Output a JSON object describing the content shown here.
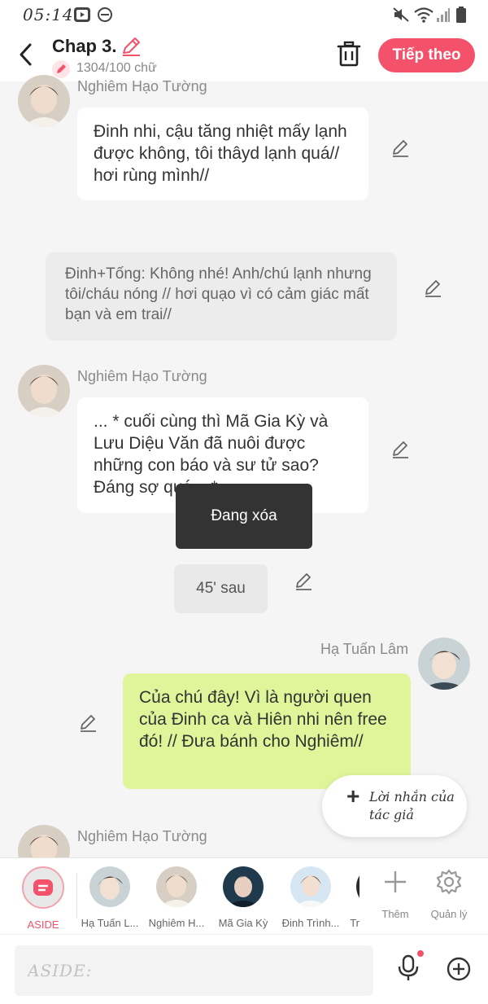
{
  "status_bar": {
    "time": "05:14"
  },
  "header": {
    "title": "Chap 3.",
    "word_count": "1304/100 chữ",
    "next_label": "Tiếp theo"
  },
  "messages": [
    {
      "sender": "Nghiêm Hạo Tường",
      "text": "Đinh nhi, cậu tăng nhiệt  mấy lạnh được không, tôi thâyd lạnh quá// hơi rùng mình//"
    },
    {
      "sender": "",
      "text": "Đinh+Tống: Không nhé! Anh/chú lạnh nhưng tôi/cháu nóng // hơi quạo vì có cảm giác mất bạn và em trai//"
    },
    {
      "sender": "Nghiêm Hạo Tường",
      "text": "... * cuối cùng thì Mã Gia Kỳ và Lưu Diệu Văn đã nuôi được những con báo và sư tử sao? Đáng sợ quá... *"
    },
    {
      "sender": "",
      "text": "45' sau"
    },
    {
      "sender": "Hạ Tuấn Lâm",
      "text": "Của chú đây! Vì là người quen của Đinh ca và Hiên nhi nên free đó! // Đưa bánh cho Nghiêm//"
    },
    {
      "sender": "Nghiêm Hạo Tường",
      "text": ""
    }
  ],
  "toast": "Đang xóa",
  "author_note": {
    "plus": "+",
    "label": "Lời nhắn của tác giả"
  },
  "characters": [
    {
      "name": "ASIDE"
    },
    {
      "name": "Hạ Tuấn L..."
    },
    {
      "name": "Nghiêm H..."
    },
    {
      "name": "Mã Gia Kỳ"
    },
    {
      "name": "Đinh Trình..."
    },
    {
      "name": "Tr"
    }
  ],
  "tools": {
    "add_label": "Thêm",
    "manage_label": "Quản lý"
  },
  "input": {
    "placeholder": "ASIDE:"
  },
  "colors": {
    "accent": "#f4516a",
    "green_bubble": "#dff59a"
  }
}
